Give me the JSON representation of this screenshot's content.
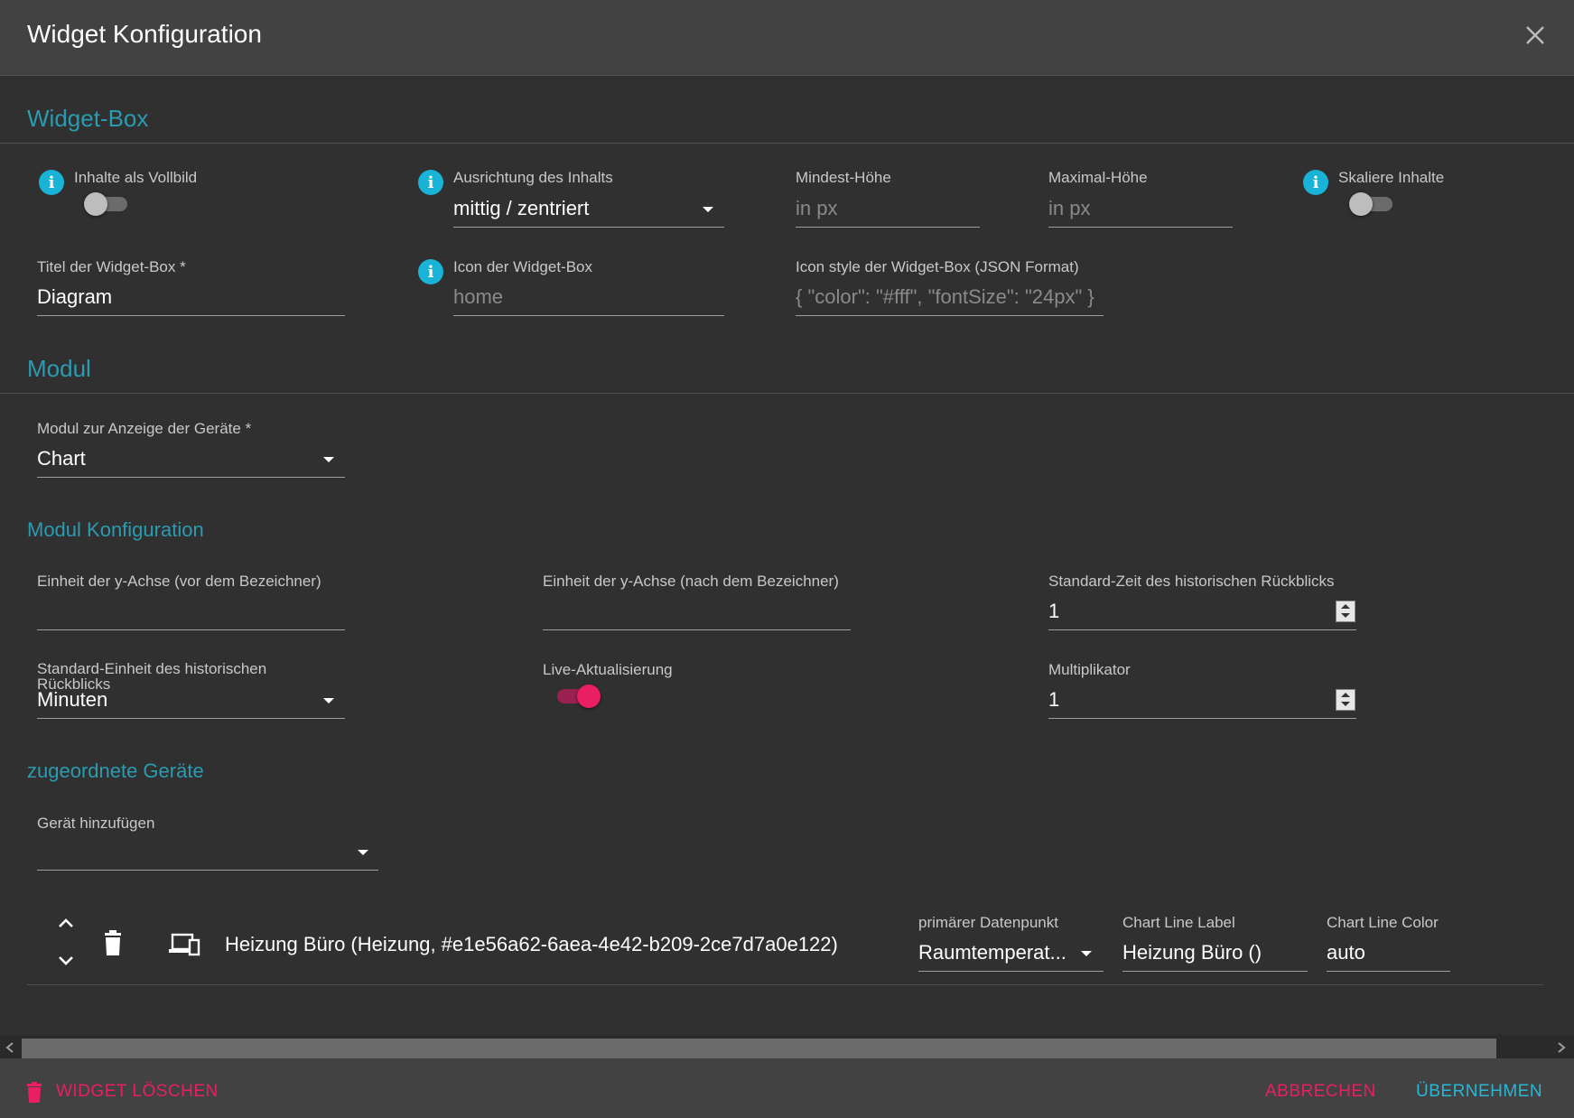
{
  "dialog": {
    "title": "Widget Konfiguration"
  },
  "sections": {
    "widget_box": "Widget-Box",
    "modul": "Modul",
    "modul_config": "Modul Konfiguration",
    "devices": "zugeordnete Geräte"
  },
  "widget_box": {
    "fullscreen": {
      "label": "Inhalte als Vollbild",
      "on": false
    },
    "alignment": {
      "label": "Ausrichtung des Inhalts",
      "value": "mittig / zentriert"
    },
    "min_height": {
      "label": "Mindest-Höhe",
      "placeholder": "in px"
    },
    "max_height": {
      "label": "Maximal-Höhe",
      "placeholder": "in px"
    },
    "scale": {
      "label": "Skaliere Inhalte",
      "on": false
    },
    "title": {
      "label": "Titel der Widget-Box *",
      "value": "Diagram"
    },
    "icon": {
      "label": "Icon der Widget-Box",
      "placeholder": "home"
    },
    "icon_style": {
      "label": "Icon style der Widget-Box (JSON Format)",
      "placeholder": "{ \"color\": \"#fff\", \"fontSize\": \"24px\" }"
    }
  },
  "modul": {
    "label": "Modul zur Anzeige der Geräte *",
    "value": "Chart"
  },
  "modul_config": {
    "y_prefix": {
      "label": "Einheit der y-Achse (vor dem Bezeichner)",
      "value": ""
    },
    "y_suffix": {
      "label": "Einheit der y-Achse (nach dem Bezeichner)",
      "value": ""
    },
    "history_time": {
      "label": "Standard-Zeit des historischen Rückblicks",
      "value": "1"
    },
    "history_unit": {
      "label_line1": "Standard-Einheit des historischen",
      "label_line2": "Rückblicks",
      "value": "Minuten"
    },
    "live_update": {
      "label": "Live-Aktualisierung",
      "on": true
    },
    "multiplier": {
      "label": "Multiplikator",
      "value": "1"
    }
  },
  "devices": {
    "add_label": "Gerät hinzufügen",
    "rows": [
      {
        "name": "Heizung Büro (Heizung, #e1e56a62-6aea-4e42-b209-2ce7d7a0e122)",
        "primary_label": "primärer Datenpunkt",
        "primary_value": "Raumtemperat...",
        "line_label_label": "Chart Line Label",
        "line_label_value": "Heizung Büro ()",
        "line_color_label": "Chart Line Color",
        "line_color_value": "auto"
      }
    ]
  },
  "footer": {
    "delete_label": "WIDGET LÖSCHEN",
    "cancel_label": "ABBRECHEN",
    "apply_label": "ÜBERNEHMEN"
  },
  "colors": {
    "accent_teal": "#2a9bb0",
    "info_blue": "#1ab3d8",
    "pink": "#e91e63",
    "background": "#303030",
    "header": "#424242"
  },
  "icons": [
    "close-icon",
    "info-icon",
    "chevron-up-icon",
    "chevron-down-icon",
    "trash-icon",
    "devices-icon",
    "arrow-left-icon",
    "arrow-right-icon"
  ]
}
